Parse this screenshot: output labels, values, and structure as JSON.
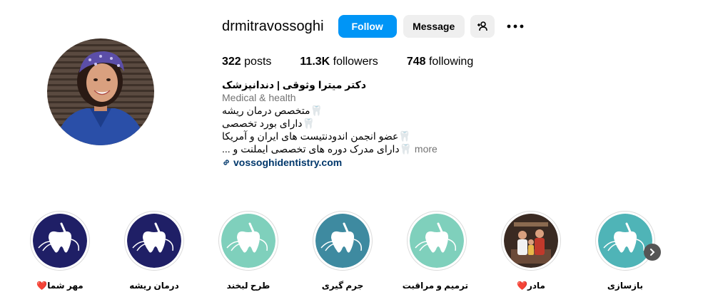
{
  "profile": {
    "username": "drmitravossoghi",
    "follow_label": "Follow",
    "message_label": "Message",
    "stats": {
      "posts_count": "322",
      "posts_label": "posts",
      "followers_count": "11.3K",
      "followers_label": "followers",
      "following_count": "748",
      "following_label": "following"
    },
    "bio": {
      "name": "دکتر میترا وثوقی | دندانپزشک",
      "category": "Medical & health",
      "lines": [
        "🦷متخصص درمان ریشه",
        "🦷دارای بورد تخصصی",
        "🦷عضو انجمن اندودنتیست های ایران و آمریکا",
        "🦷دارای مدرک دوره های تخصصی ایملنت و ..."
      ],
      "more_label": "more",
      "link": "vossoghidentistry.com"
    }
  },
  "highlights": [
    {
      "label": "مهر شما",
      "heart": "❤️"
    },
    {
      "label": "درمان ریشه",
      "heart": ""
    },
    {
      "label": "طرح لبخند",
      "heart": ""
    },
    {
      "label": "جرم گیری",
      "heart": ""
    },
    {
      "label": "ترمیم و مراقبت",
      "heart": ""
    },
    {
      "label": "مادر",
      "heart": "❤️"
    },
    {
      "label": "بازسازی",
      "heart": ""
    }
  ],
  "colors": {
    "follow_blue": "#0095f6",
    "navy": "#1f1f66",
    "mint": "#7fd0bc",
    "teal": "#3e8aa0",
    "teal_light": "#4fb4b7"
  },
  "icons": {
    "add_user": "add-user-icon",
    "more": "more-options-icon",
    "link": "link-icon",
    "next": "chevron-right-icon"
  }
}
